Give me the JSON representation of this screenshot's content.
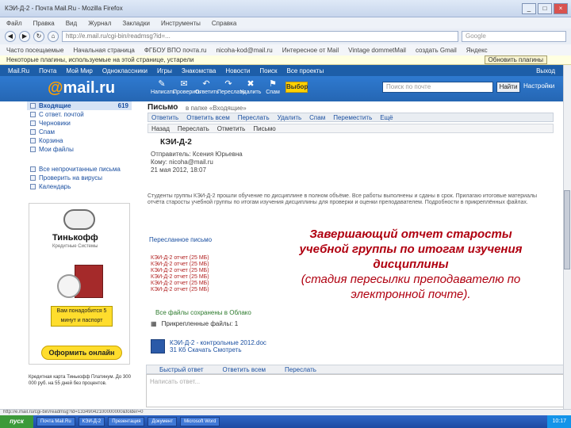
{
  "window": {
    "title": "КЭИ-Д-2 - Почта Mail.Ru - Mozilla Firefox"
  },
  "menu": [
    "Файл",
    "Правка",
    "Вид",
    "Журнал",
    "Закладки",
    "Инструменты",
    "Справка"
  ],
  "address": {
    "url": "http://e.mail.ru/cgi-bin/readmsg?id=...",
    "search_placeholder": "Google"
  },
  "bookmarks": [
    "Часто посещаемые",
    "Начальная страница",
    "ФГБОУ ВПО почта.ru",
    "nicoha-kod@mail.ru",
    "Интересное от Mail",
    "Vintage  dommetMail",
    "создать  Gmail",
    "Яндекс"
  ],
  "infobar": {
    "text": "Некоторые плагины, используемые на этой странице, устарели",
    "button": "Обновить плагины"
  },
  "mailnav": {
    "items": [
      "Mail.Ru",
      "Почта",
      "Мой Мир",
      "Одноклассники",
      "Игры",
      "Знакомства",
      "Новости",
      "Поиск",
      "Все проекты"
    ],
    "right": "Выход"
  },
  "toolbar": {
    "logo_at": "@",
    "logo_text": "mail.ru",
    "buttons": [
      {
        "icon": "✎",
        "label": "Написать"
      },
      {
        "icon": "✉",
        "label": "Проверить"
      },
      {
        "icon": "↶",
        "label": "Ответить"
      },
      {
        "icon": "↷",
        "label": "Переслать"
      },
      {
        "icon": "✖",
        "label": "Удалить"
      },
      {
        "icon": "⚑",
        "label": "Спам"
      }
    ],
    "ballot": "Выбор",
    "search_placeholder": "Поиск по почте",
    "find": "Найти",
    "more": "Настройки"
  },
  "sidebar": {
    "folders": [
      {
        "label": "Входящие",
        "count": "619",
        "active": true
      },
      {
        "label": "С ответ. почтой"
      },
      {
        "label": "Черновики"
      },
      {
        "label": "Спам"
      },
      {
        "label": "Корзина"
      },
      {
        "label": "Мои файлы"
      }
    ],
    "extra": [
      "Все непрочитанные письма",
      "Проверить на вирусы",
      "Календарь"
    ]
  },
  "ad": {
    "brand": "Тинькофф",
    "sub": "Кредитные Системы",
    "yellow": "Вам понадобится 5 минут и паспорт",
    "button": "Оформить онлайн",
    "note": "Кредитная карта Тинькофф Платинум. До 300 000 руб. на 55 дней без процентов."
  },
  "message": {
    "header": "Письмо",
    "path": "в папке «Входящие»",
    "tools": [
      "Ответить",
      "Ответить всем",
      "Переслать",
      "Удалить",
      "Спам",
      "Переместить",
      "Ещё"
    ],
    "tools2": [
      "Назад",
      "Переслать",
      "Отметить",
      "Письмо"
    ],
    "subject": "КЭИ-Д-2",
    "from": "Отправитель: Ксения Юрьевна",
    "to": "Кому: nicoha@mail.ru",
    "date": "21 мая 2012, 18:07",
    "body": "Студенты группы КЭИ-Д-2 прошли обучение по дисциплине в полном объёме. Все работы выполнены и сданы в срок. Прилагаю итоговые материалы отчёта старосты учебной группы по итогам изучения дисциплины для проверки и оценки преподавателем. Подробности в прикреплённых файлах.",
    "forwarded": "Пересланное письмо",
    "attachments": [
      "КЭИ-Д-2 отчет (25 МБ)",
      "КЭИ-Д-2 отчет (25 МБ)",
      "КЭИ-Д-2 отчет (25 МБ)",
      "КЭИ-Д-2 отчет (25 МБ)",
      "КЭИ-Д-2 отчет (25 МБ)",
      "КЭИ-Д-2 отчет (25 МБ)"
    ],
    "saved": "Все файлы сохранены в Облако",
    "download_all": "Прикрепленные файлы: 1",
    "file_name": "КЭИ-Д-2 - контрольные  2012.doc",
    "file_meta": "31 Кб   Скачать   Смотреть",
    "reply_actions": [
      "Быстрый ответ",
      "Ответить всем",
      "Переслать"
    ],
    "reply_placeholder": "Написать ответ..."
  },
  "caption": {
    "line1": "Завершающий отчет старосты",
    "line2": "учебной группы по итогам изучения",
    "line3": "дисциплины",
    "line4": "(стадия пересылки  преподавателю по",
    "line5": "электронной почте)."
  },
  "status": "http://e.mail.ru/cgi-bin/readmsg?id=13349042100000000&folder=0",
  "taskbar": {
    "start": "пуск",
    "tasks": [
      "Почта Mail.Ru",
      "КЭИ-Д-2",
      "Презентация",
      "Документ",
      "Microsoft Word"
    ],
    "clock": "10:17"
  }
}
